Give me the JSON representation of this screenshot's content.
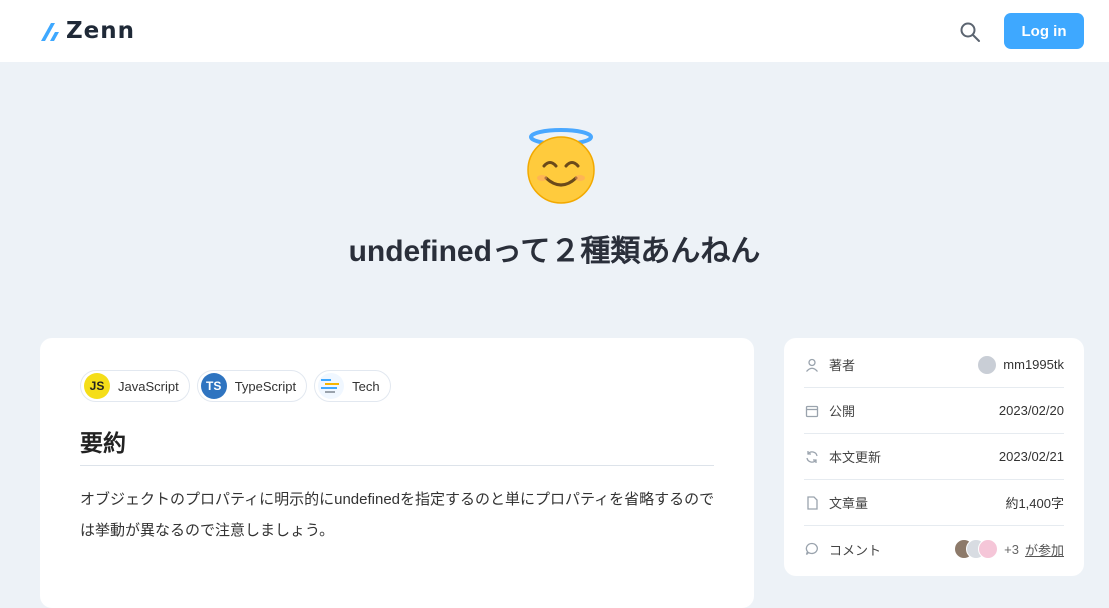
{
  "header": {
    "logo_text": "Zenn",
    "search_icon": "search-icon",
    "login_label": "Log in"
  },
  "article": {
    "emoji_icon": "smiling-face-with-halo-icon",
    "title": "undefinedって２種類あんねん"
  },
  "topics": [
    {
      "label": "JavaScript",
      "icon_text": "JS",
      "color": "#f5de19"
    },
    {
      "label": "TypeScript",
      "icon_text": "TS",
      "color": "#2f74c0"
    },
    {
      "label": "Tech",
      "icon_text": "",
      "color": "#3ea8ff"
    }
  ],
  "content": {
    "heading": "要約",
    "paragraph": "オブジェクトのプロパティに明示的にundefinedを指定するのと単にプロパティを省略するのでは挙動が異なるので注意しましょう。"
  },
  "sidebar": {
    "author_label": "著者",
    "author_name": "mm1995tk",
    "published_label": "公開",
    "published_date": "2023/02/20",
    "updated_label": "本文更新",
    "updated_date": "2023/02/21",
    "length_label": "文章量",
    "length_value": "約1,400字",
    "comment_label": "コメント",
    "comment_extra": "+3",
    "comment_link": "が参加"
  },
  "colors": {
    "accent": "#3ea8ff",
    "background": "#edf2f7"
  }
}
